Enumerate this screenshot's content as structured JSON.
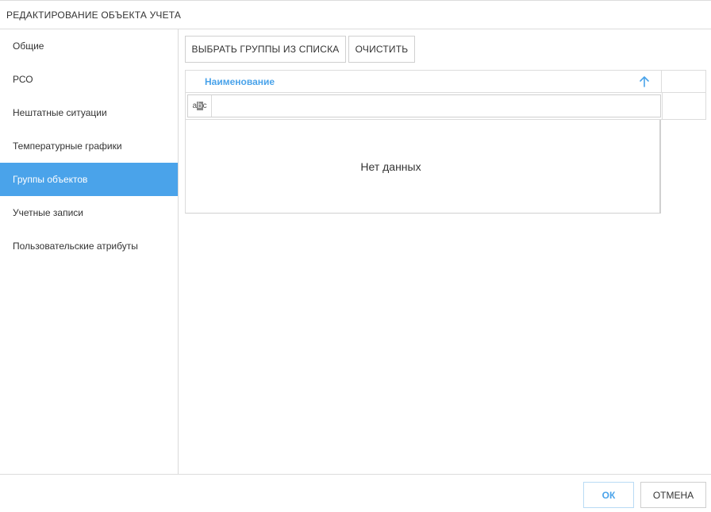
{
  "dialog": {
    "title": "РЕДАКТИРОВАНИЕ ОБЪЕКТА УЧЕТА"
  },
  "sidebar": {
    "items": [
      {
        "label": "Общие",
        "active": false
      },
      {
        "label": "РСО",
        "active": false
      },
      {
        "label": "Нештатные ситуации",
        "active": false
      },
      {
        "label": "Температурные графики",
        "active": false
      },
      {
        "label": "Группы объектов",
        "active": true
      },
      {
        "label": "Учетные записи",
        "active": false
      },
      {
        "label": "Пользовательские атрибуты",
        "active": false
      }
    ]
  },
  "toolbar": {
    "select_groups_label": "ВЫБРАТЬ ГРУППЫ ИЗ СПИСКА",
    "clear_label": "ОЧИСТИТЬ"
  },
  "grid": {
    "columns": [
      {
        "header": "Наименование",
        "sort": "ascending"
      }
    ],
    "filter": {
      "icon": "text-filter-icon",
      "icon_text_a": "a",
      "icon_text_b": "b",
      "icon_text_c": "c",
      "value": "",
      "placeholder": ""
    },
    "empty_text": "Нет данных",
    "rows": []
  },
  "footer": {
    "ok_label": "ОК",
    "cancel_label": "ОТМЕНА"
  },
  "colors": {
    "accent": "#4aa3ea",
    "border": "#dcdcdc",
    "text": "#333333"
  }
}
